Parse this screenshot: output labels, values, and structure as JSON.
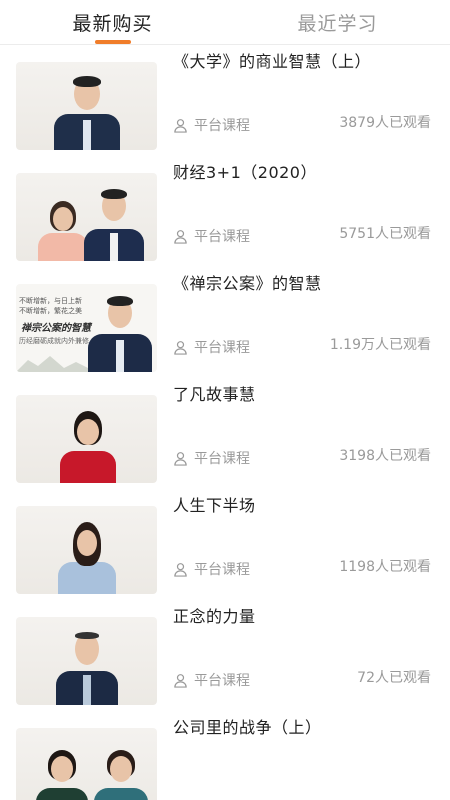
{
  "colors": {
    "accent": "#f07d2a",
    "text_primary": "#222222",
    "text_secondary": "#9a9a9a"
  },
  "tabs": [
    {
      "label": "最新购买",
      "active": true
    },
    {
      "label": "最近学习",
      "active": false
    }
  ],
  "courses": [
    {
      "title": "《大学》的商业智慧（上）",
      "source": "平台课程",
      "views": "3879人已观看"
    },
    {
      "title": "财经3+1（2020）",
      "source": "平台课程",
      "views": "5751人已观看"
    },
    {
      "title": "《禅宗公案》的智慧",
      "source": "平台课程",
      "views": "1.19万人已观看",
      "banner": {
        "line1": "不断增新，与日上新",
        "line2": "不断增新，繁花之美",
        "big": "禅宗公案的智慧",
        "line3": "历经磨砺成就内外兼修"
      }
    },
    {
      "title": "了凡故事慧",
      "source": "平台课程",
      "views": "3198人已观看"
    },
    {
      "title": "人生下半场",
      "source": "平台课程",
      "views": "1198人已观看"
    },
    {
      "title": "正念的力量",
      "source": "平台课程",
      "views": "72人已观看"
    },
    {
      "title": "公司里的战争（上）",
      "source": "平台课程",
      "views": ""
    }
  ],
  "icons": {
    "source_icon": "user-outline-icon"
  }
}
